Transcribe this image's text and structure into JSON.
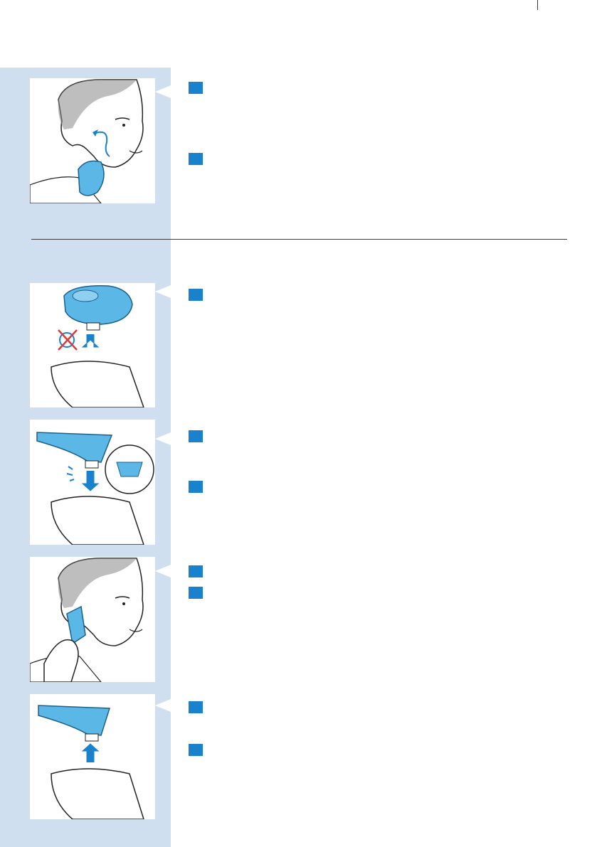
{
  "page": {
    "background": "#ffffff",
    "sidebar_color": "#cfdff0",
    "accent": "#1a82cc"
  },
  "sections": [
    {
      "illustration": "man-shaving-circular-motion-icon",
      "steps": [
        {
          "number": ""
        },
        {
          "number": ""
        }
      ]
    },
    {
      "illustration": "shaving-unit-removal-icon",
      "steps": [
        {
          "number": ""
        }
      ]
    },
    {
      "illustration": "styler-attachment-icon",
      "steps": [
        {
          "number": ""
        },
        {
          "number": ""
        }
      ]
    },
    {
      "illustration": "man-styling-sideburns-icon",
      "steps": [
        {
          "number": ""
        },
        {
          "number": ""
        }
      ]
    },
    {
      "illustration": "styler-removal-icon",
      "steps": [
        {
          "number": ""
        },
        {
          "number": ""
        }
      ]
    }
  ]
}
